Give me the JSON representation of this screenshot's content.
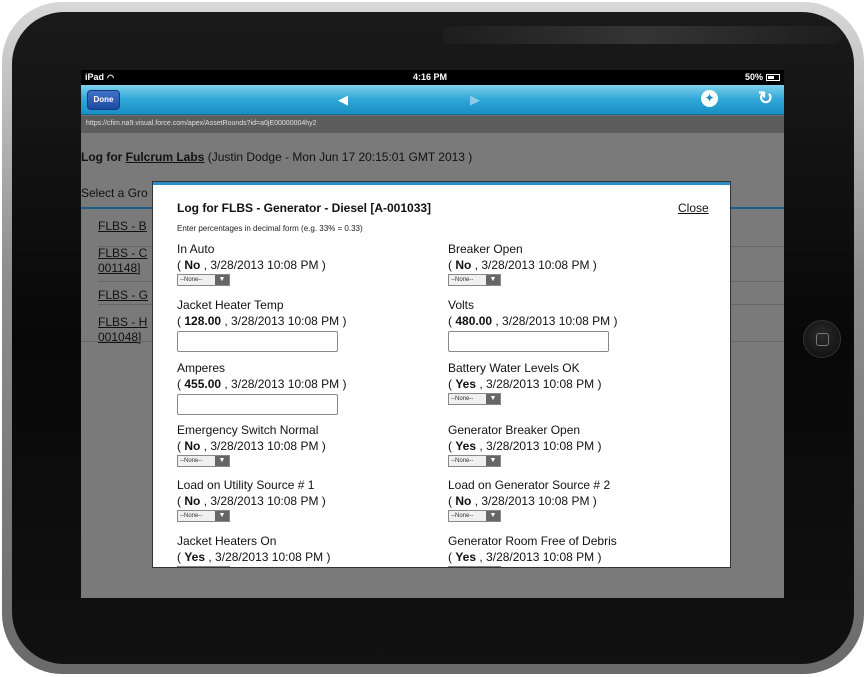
{
  "status_bar": {
    "device": "iPad",
    "time": "4:16 PM",
    "battery": "50%"
  },
  "nav": {
    "done_label": "Done",
    "back_arrow": "◀",
    "forward_arrow": "▶",
    "globe_icon": "globe-icon",
    "refresh_icon": "refresh-icon"
  },
  "url": "https://cfim.na9.visual.force.com/apex/AssetRounds?id=a0jE00000004hy2",
  "page": {
    "log_prefix": "Log for",
    "org": "Fulcrum Labs",
    "meta": "(Justin Dodge  - Mon Jun 17 20:15:01 GMT 2013 )",
    "select_group": "Select a Gro",
    "bg_links": [
      "FLBS - B",
      "FLBS - C",
      "001148]",
      "FLBS - G",
      "FLBS - H",
      "001048]"
    ]
  },
  "modal": {
    "title": "Log for FLBS - Generator - Diesel [A-001033]",
    "close_label": "Close",
    "hint": "Enter percentages in decimal form (e.g. 33% = 0.33)",
    "select_placeholder": "--None--",
    "fields": [
      {
        "label": "In Auto",
        "value": "No",
        "date": ", 3/28/2013 10:08 PM )"
      },
      {
        "label": "Breaker Open",
        "value": "No",
        "date": ", 3/28/2013 10:08 PM )"
      },
      {
        "label": "Jacket Heater Temp",
        "value": "128.00",
        "date": ", 3/28/2013 10:08 PM )"
      },
      {
        "label": "Volts",
        "value": "480.00",
        "date": ", 3/28/2013 10:08 PM )"
      },
      {
        "label": "Amperes",
        "value": "455.00",
        "date": ", 3/28/2013 10:08 PM )"
      },
      {
        "label": "Battery Water Levels OK",
        "value": "Yes",
        "date": ", 3/28/2013 10:08 PM )"
      },
      {
        "label": "Emergency Switch Normal",
        "value": "No",
        "date": ", 3/28/2013 10:08 PM )"
      },
      {
        "label": "Generator Breaker Open",
        "value": "Yes",
        "date": ", 3/28/2013 10:08 PM )"
      },
      {
        "label": "Load on Utility Source # 1",
        "value": "No",
        "date": ", 3/28/2013 10:08 PM )"
      },
      {
        "label": "Load on Generator Source # 2",
        "value": "No",
        "date": ", 3/28/2013 10:08 PM )"
      },
      {
        "label": "Jacket Heaters On",
        "value": "Yes",
        "date": ", 3/28/2013 10:08 PM )"
      },
      {
        "label": "Generator Room Free of Debris",
        "value": "Yes",
        "date": ", 3/28/2013 10:08 PM )"
      }
    ]
  },
  "colors": {
    "nav_blue": "#2fa7d7",
    "modal_accent": "#2c8fc8",
    "overlay_gray": "#7a7a7a"
  }
}
